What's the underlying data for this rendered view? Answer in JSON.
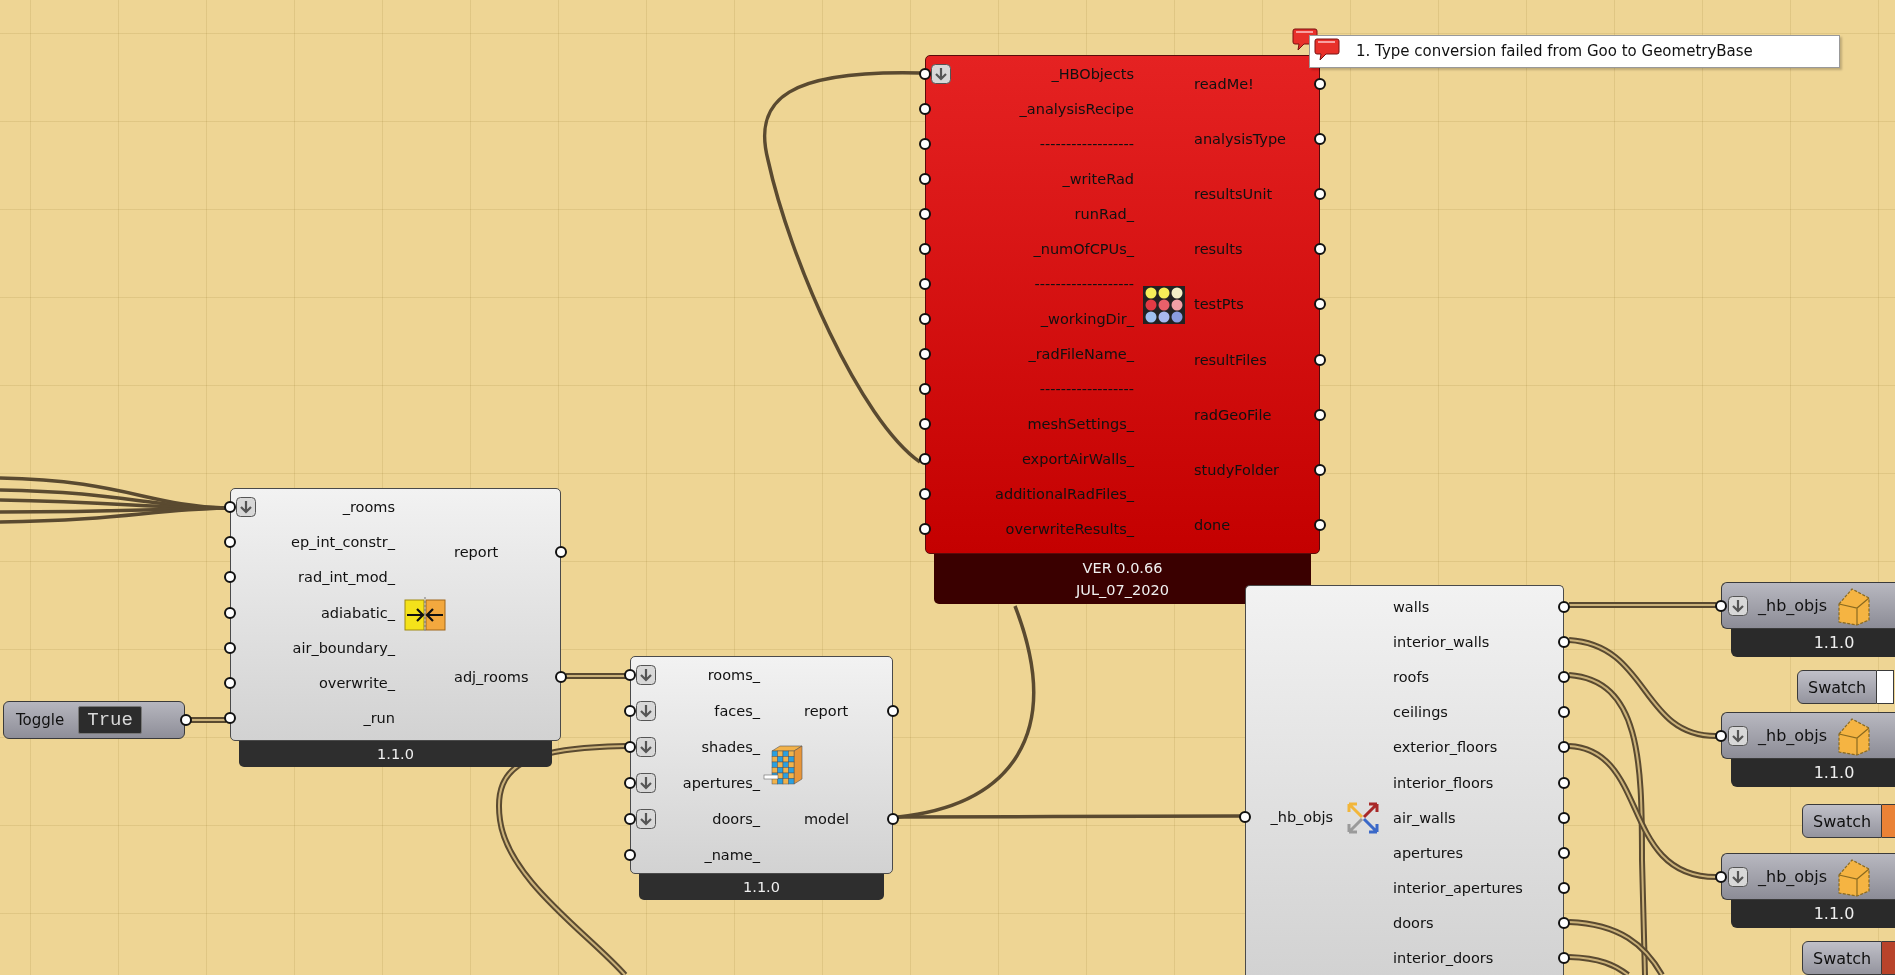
{
  "components": [
    {
      "error": true,
      "inputs": [
        {
          "label": "_HBObjects",
          "flatten": true
        },
        {
          "label": "_analysisRecipe",
          "flatten": false
        },
        {
          "label": "------------------",
          "flatten": false
        },
        {
          "label": "_writeRad",
          "flatten": false
        },
        {
          "label": "runRad_",
          "flatten": false
        },
        {
          "label": "_numOfCPUs_",
          "flatten": false
        },
        {
          "label": "-------------------",
          "flatten": false
        },
        {
          "label": "_workingDir_",
          "flatten": false
        },
        {
          "label": "_radFileName_",
          "flatten": false
        },
        {
          "label": "------------------",
          "flatten": false
        },
        {
          "label": "meshSettings_",
          "flatten": false
        },
        {
          "label": "exportAirWalls_",
          "flatten": false
        },
        {
          "label": "additionalRadFiles_",
          "flatten": false
        },
        {
          "label": "overwriteResults_",
          "flatten": false
        }
      ],
      "outputs": [
        "readMe!",
        "analysisType",
        "resultsUnit",
        "results",
        "testPts",
        "resultFiles",
        "radGeoFile",
        "studyFolder",
        "done"
      ],
      "version": [
        "VER 0.0.66",
        "JUL_07_2020"
      ]
    },
    {
      "error": false,
      "inputs": [
        {
          "label": "_rooms",
          "flatten": true
        },
        {
          "label": "ep_int_constr_",
          "flatten": false
        },
        {
          "label": "rad_int_mod_",
          "flatten": false
        },
        {
          "label": "adiabatic_",
          "flatten": false
        },
        {
          "label": "air_boundary_",
          "flatten": false
        },
        {
          "label": "overwrite_",
          "flatten": false
        },
        {
          "label": "_run",
          "flatten": false
        }
      ],
      "outputs": [
        "report",
        "adj_rooms"
      ],
      "version": [
        "1.1.0"
      ]
    },
    {
      "error": false,
      "inputs": [
        {
          "label": "rooms_",
          "flatten": true
        },
        {
          "label": "faces_",
          "flatten": true
        },
        {
          "label": "shades_",
          "flatten": true
        },
        {
          "label": "apertures_",
          "flatten": true
        },
        {
          "label": "doors_",
          "flatten": true
        },
        {
          "label": "_name_",
          "flatten": false
        }
      ],
      "outputs": [
        "report",
        "model"
      ],
      "version": [
        "1.1.0"
      ]
    },
    {
      "error": false,
      "inputs": [
        {
          "label": "_hb_objs",
          "flatten": false
        }
      ],
      "outputs": [
        "walls",
        "interior_walls",
        "roofs",
        "ceilings",
        "exterior_floors",
        "interior_floors",
        "air_walls",
        "apertures",
        "interior_apertures",
        "doors",
        "interior_doors"
      ]
    }
  ],
  "toggle": {
    "label": "Toggle",
    "value": "True"
  },
  "hb_nodes": [
    {
      "input": "_hb_objs",
      "flatten": true,
      "version": "1.1.0"
    },
    {
      "input": "_hb_objs",
      "flatten": true,
      "version": "1.1.0"
    },
    {
      "input": "_hb_objs",
      "flatten": true,
      "version": "1.1.0"
    }
  ],
  "swatches": [
    {
      "label": "Swatch",
      "color": "#ffffff"
    },
    {
      "label": "Swatch",
      "color": "#ea8236"
    },
    {
      "label": "Swatch",
      "color": "#b8432a"
    }
  ],
  "error_tooltip": {
    "text": "1. Type conversion failed from Goo to GeometryBase"
  }
}
